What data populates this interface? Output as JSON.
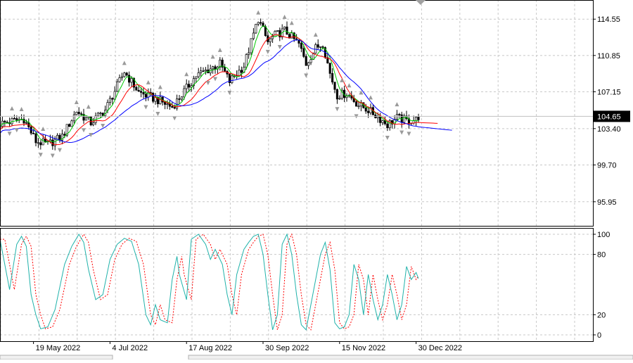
{
  "chart_data": [
    {
      "type": "candlestick",
      "panel": "price",
      "ylim": [
        93.5,
        116.5
      ],
      "y_ticks": [
        "114.55",
        "110.85",
        "107.15",
        "103.40",
        "99.70",
        "95.95"
      ],
      "y_tick_values": [
        114.55,
        110.85,
        107.15,
        103.4,
        99.7,
        95.95
      ],
      "current_price": "104.65",
      "current_price_value": 104.65,
      "x_labels": [
        "19 May 2022",
        "4 Jul 2022",
        "17 Aug 2022",
        "30 Sep 2022",
        "15 Nov 2022",
        "30 Dec 2022"
      ],
      "x_label_bars": [
        14,
        46,
        78,
        110,
        142,
        174
      ],
      "bar_count": 176,
      "anchors": [
        [
          0,
          103.9
        ],
        [
          10,
          104.4
        ],
        [
          15,
          102.1
        ],
        [
          20,
          101.8
        ],
        [
          26,
          102.6
        ],
        [
          32,
          105.2
        ],
        [
          38,
          104.0
        ],
        [
          44,
          105.3
        ],
        [
          52,
          109.2
        ],
        [
          58,
          107.1
        ],
        [
          66,
          106.3
        ],
        [
          72,
          105.6
        ],
        [
          78,
          107.5
        ],
        [
          82,
          108.8
        ],
        [
          92,
          110.0
        ],
        [
          96,
          108.2
        ],
        [
          102,
          109.8
        ],
        [
          106,
          113.0
        ],
        [
          108,
          114.6
        ],
        [
          112,
          112.2
        ],
        [
          115,
          112.9
        ],
        [
          119,
          113.4
        ],
        [
          125,
          112.0
        ],
        [
          128,
          110.0
        ],
        [
          132,
          111.6
        ],
        [
          135,
          112.1
        ],
        [
          138,
          109.0
        ],
        [
          141,
          106.8
        ],
        [
          145,
          107.0
        ],
        [
          150,
          105.8
        ],
        [
          154,
          105.3
        ],
        [
          158,
          104.6
        ],
        [
          162,
          103.8
        ],
        [
          166,
          104.5
        ],
        [
          170,
          104.2
        ],
        [
          174,
          104.3
        ],
        [
          175,
          104.65
        ]
      ],
      "series": [
        {
          "kind": "ma",
          "period": 5,
          "color": "#00c800"
        },
        {
          "kind": "ma",
          "period": 10,
          "color": "#ff0000"
        },
        {
          "kind": "ma",
          "period": 20,
          "color": "#0000ff"
        }
      ],
      "ma_extension_bars": 8
    },
    {
      "type": "line",
      "panel": "stochastic",
      "ylim": [
        0,
        100
      ],
      "y_ticks": [
        "100",
        "80",
        "20",
        "0"
      ],
      "y_tick_values": [
        100,
        80,
        20,
        0
      ],
      "series": [
        {
          "kind": "main",
          "color": "#20b2aa",
          "style": "solid",
          "anchors": [
            [
              0,
              95
            ],
            [
              2,
              70
            ],
            [
              4,
              45
            ],
            [
              7,
              90
            ],
            [
              9,
              98
            ],
            [
              11,
              88
            ],
            [
              13,
              40
            ],
            [
              15,
              20
            ],
            [
              17,
              6
            ],
            [
              20,
              8
            ],
            [
              23,
              25
            ],
            [
              27,
              70
            ],
            [
              30,
              88
            ],
            [
              33,
              100
            ],
            [
              35,
              92
            ],
            [
              37,
              65
            ],
            [
              40,
              35
            ],
            [
              43,
              40
            ],
            [
              46,
              75
            ],
            [
              49,
              90
            ],
            [
              52,
              96
            ],
            [
              55,
              93
            ],
            [
              58,
              70
            ],
            [
              61,
              20
            ],
            [
              63,
              10
            ],
            [
              65,
              30
            ],
            [
              67,
              15
            ],
            [
              70,
              12
            ],
            [
              72,
              55
            ],
            [
              74,
              78
            ],
            [
              75,
              60
            ],
            [
              78,
              35
            ],
            [
              80,
              95
            ],
            [
              83,
              100
            ],
            [
              86,
              90
            ],
            [
              88,
              75
            ],
            [
              90,
              85
            ],
            [
              93,
              70
            ],
            [
              95,
              40
            ],
            [
              97,
              20
            ],
            [
              99,
              60
            ],
            [
              102,
              85
            ],
            [
              104,
              92
            ],
            [
              106,
              98
            ],
            [
              108,
              100
            ],
            [
              110,
              80
            ],
            [
              112,
              40
            ],
            [
              114,
              5
            ],
            [
              116,
              20
            ],
            [
              118,
              90
            ],
            [
              120,
              100
            ],
            [
              122,
              80
            ],
            [
              124,
              40
            ],
            [
              126,
              10
            ],
            [
              128,
              5
            ],
            [
              130,
              30
            ],
            [
              132,
              55
            ],
            [
              134,
              80
            ],
            [
              136,
              92
            ],
            [
              138,
              65
            ],
            [
              140,
              12
            ],
            [
              142,
              6
            ],
            [
              144,
              8
            ],
            [
              146,
              20
            ],
            [
              148,
              70
            ],
            [
              150,
              55
            ],
            [
              152,
              20
            ],
            [
              154,
              60
            ],
            [
              156,
              35
            ],
            [
              158,
              15
            ],
            [
              160,
              30
            ],
            [
              162,
              60
            ],
            [
              164,
              40
            ],
            [
              166,
              15
            ],
            [
              168,
              30
            ],
            [
              170,
              68
            ],
            [
              172,
              55
            ],
            [
              174,
              62
            ],
            [
              176,
              50
            ],
            [
              178,
              45
            ],
            [
              180,
              55
            ]
          ]
        },
        {
          "kind": "signal",
          "color": "#ff0000",
          "style": "dashed",
          "lag_bars": 2
        }
      ]
    }
  ]
}
